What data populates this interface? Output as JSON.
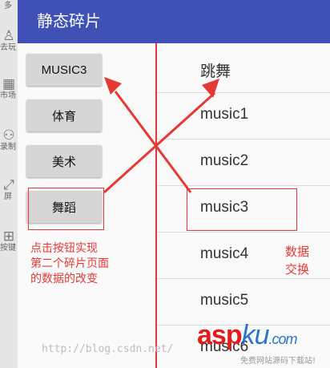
{
  "side_strip": {
    "items": [
      {
        "icon": "menu-more-icon",
        "glyph": "⋯",
        "label": "多"
      },
      {
        "icon": "person-icon",
        "glyph": "♙",
        "label": "去玩"
      },
      {
        "icon": "store-icon",
        "glyph": "▦",
        "label": "市场"
      },
      {
        "icon": "recorder-icon",
        "glyph": "⚇",
        "label": "录制"
      },
      {
        "icon": "screen-icon",
        "glyph": "⤢",
        "label": "屏"
      },
      {
        "icon": "keypad-icon",
        "glyph": "⊞",
        "label": "按键"
      }
    ]
  },
  "app_bar": {
    "title": "静态碎片",
    "color": "#3f51b5"
  },
  "left_fragment": {
    "buttons": [
      {
        "label": "MUSIC3"
      },
      {
        "label": "体育"
      },
      {
        "label": "美术"
      },
      {
        "label": "舞蹈"
      }
    ]
  },
  "right_fragment": {
    "items": [
      {
        "label": "跳舞"
      },
      {
        "label": "music1"
      },
      {
        "label": "music2"
      },
      {
        "label": "music3"
      },
      {
        "label": "music4"
      },
      {
        "label": "music5"
      },
      {
        "label": "music6"
      }
    ]
  },
  "annotations": {
    "left_note": [
      "点击按钮实现",
      "第二个碎片页面",
      "的数据的改变"
    ],
    "right_note": [
      "数据",
      "交换"
    ],
    "color": "#e53935"
  },
  "watermark": {
    "url": "http://blog.csdn.net/",
    "logo_red": "asp",
    "logo_blue": "ku",
    "logo_suffix": ".com",
    "logo_sub": "免费网站源码下载站!"
  }
}
